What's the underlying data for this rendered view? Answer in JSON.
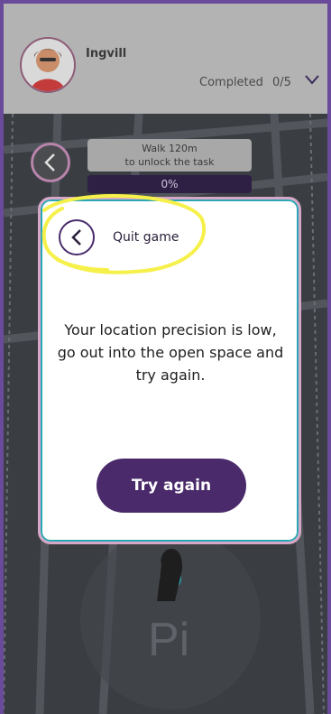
{
  "header": {
    "username": "Ingvill",
    "completed_label": "Completed",
    "completed_value": "0/5"
  },
  "map": {
    "walk_title": "Walk 120m",
    "walk_subtitle": "to unlock the task",
    "progress_text": "0%"
  },
  "dialog": {
    "quit_label": "Quit game",
    "message_lines": [
      "Your location precision is low,",
      "go out into the open space and",
      "try again."
    ],
    "primary_button": "Try again"
  }
}
